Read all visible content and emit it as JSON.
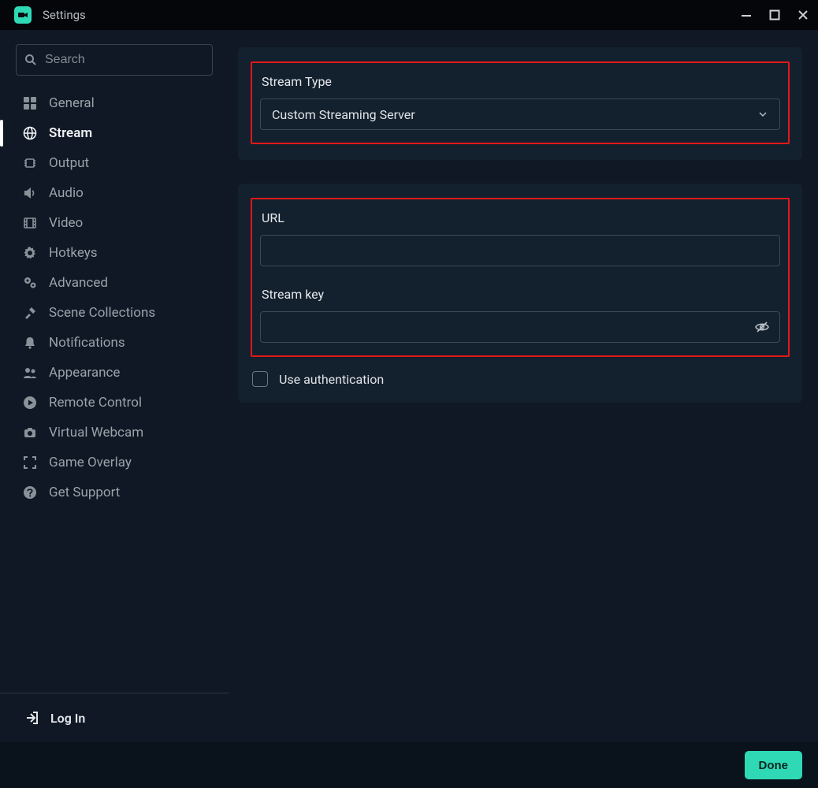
{
  "window": {
    "title": "Settings"
  },
  "search": {
    "placeholder": "Search",
    "value": ""
  },
  "nav": {
    "items": [
      {
        "label": "General",
        "icon": "grid-icon",
        "active": false
      },
      {
        "label": "Stream",
        "icon": "globe-icon",
        "active": true
      },
      {
        "label": "Output",
        "icon": "chip-icon",
        "active": false
      },
      {
        "label": "Audio",
        "icon": "speaker-icon",
        "active": false
      },
      {
        "label": "Video",
        "icon": "film-icon",
        "active": false
      },
      {
        "label": "Hotkeys",
        "icon": "gear-icon",
        "active": false
      },
      {
        "label": "Advanced",
        "icon": "gears-icon",
        "active": false
      },
      {
        "label": "Scene Collections",
        "icon": "tools-icon",
        "active": false
      },
      {
        "label": "Notifications",
        "icon": "bell-icon",
        "active": false
      },
      {
        "label": "Appearance",
        "icon": "people-icon",
        "active": false
      },
      {
        "label": "Remote Control",
        "icon": "play-circle-icon",
        "active": false
      },
      {
        "label": "Virtual Webcam",
        "icon": "camera-icon",
        "active": false
      },
      {
        "label": "Game Overlay",
        "icon": "expand-icon",
        "active": false
      },
      {
        "label": "Get Support",
        "icon": "help-icon",
        "active": false
      }
    ],
    "login": "Log In"
  },
  "stream": {
    "type_label": "Stream Type",
    "type_value": "Custom Streaming Server",
    "url_label": "URL",
    "url_value": "",
    "key_label": "Stream key",
    "key_value": "",
    "use_auth_label": "Use authentication",
    "use_auth_checked": false
  },
  "footer": {
    "done": "Done"
  }
}
